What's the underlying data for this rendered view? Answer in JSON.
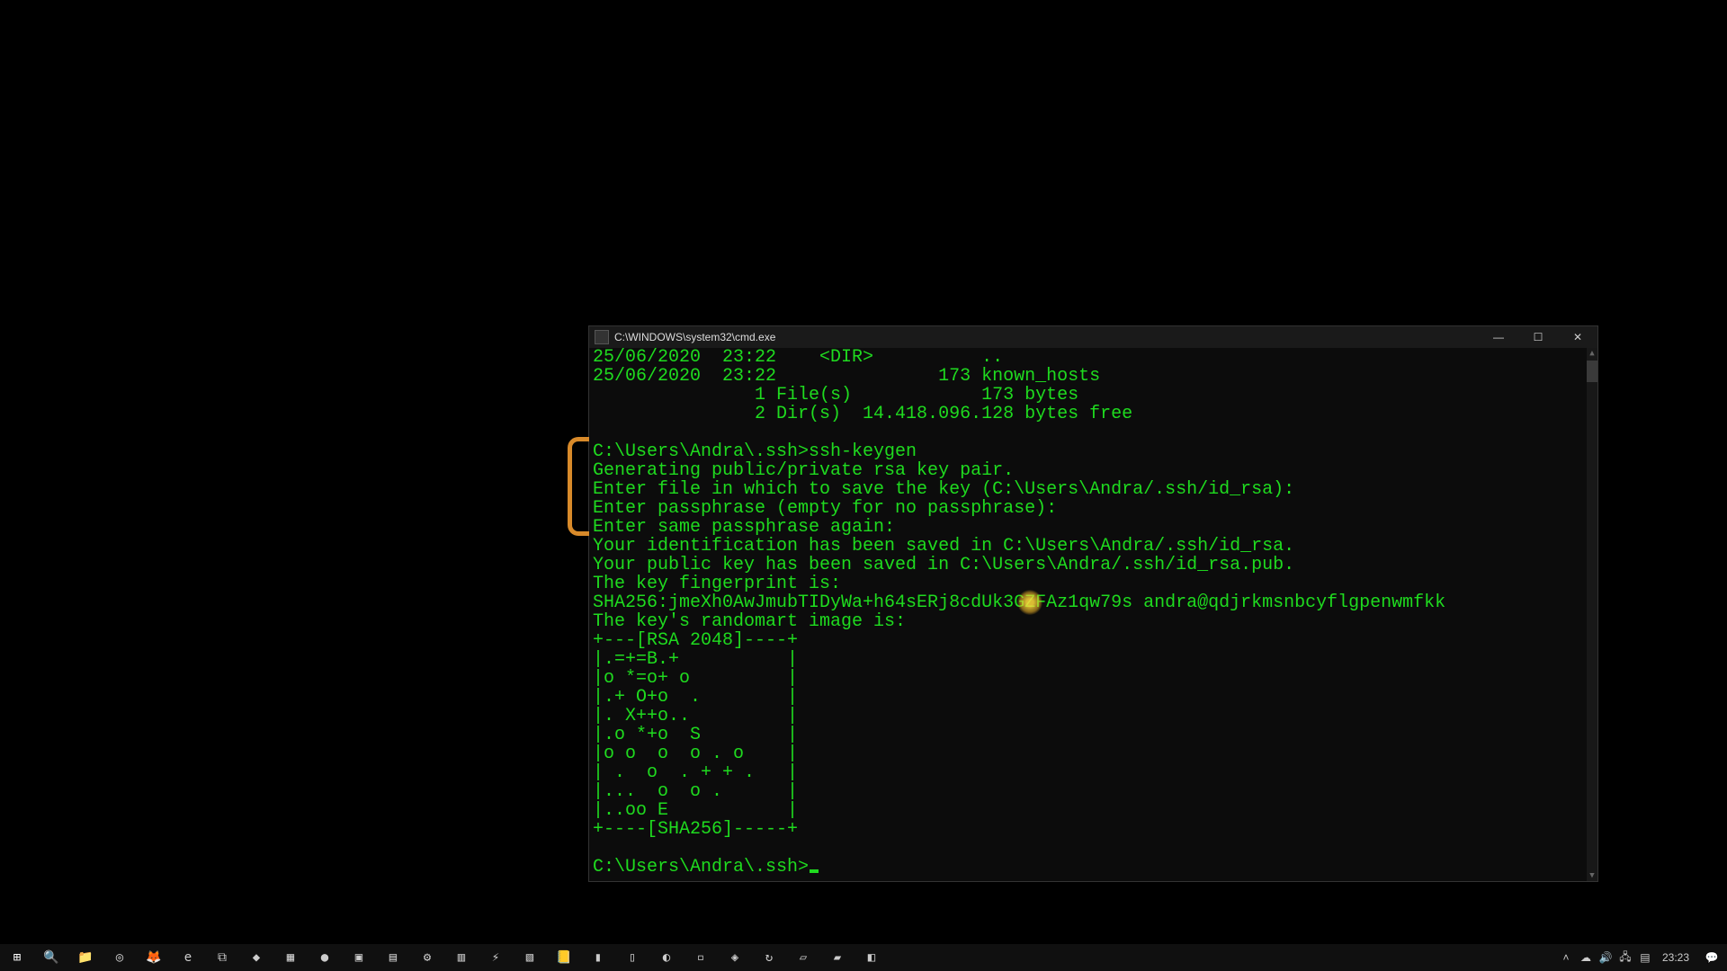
{
  "window": {
    "title": "C:\\WINDOWS\\system32\\cmd.exe",
    "minimize": "—",
    "maximize": "☐",
    "close": "✕"
  },
  "terminal": {
    "lines": [
      "25/06/2020  23:22    <DIR>          ..",
      "25/06/2020  23:22               173 known_hosts",
      "               1 File(s)            173 bytes",
      "               2 Dir(s)  14.418.096.128 bytes free",
      "",
      "C:\\Users\\Andra\\.ssh>ssh-keygen",
      "Generating public/private rsa key pair.",
      "Enter file in which to save the key (C:\\Users\\Andra/.ssh/id_rsa):",
      "Enter passphrase (empty for no passphrase):",
      "Enter same passphrase again:",
      "Your identification has been saved in C:\\Users\\Andra/.ssh/id_rsa.",
      "Your public key has been saved in C:\\Users\\Andra/.ssh/id_rsa.pub.",
      "The key fingerprint is:",
      "SHA256:jmeXh0AwJmubTIDyWa+h64sERj8cdUk3GZFAz1qw79s andra@qdjrkmsnbcyflgpenwmfkk",
      "The key's randomart image is:",
      "+---[RSA 2048]----+",
      "|.=+=B.+          |",
      "|o *=o+ o         |",
      "|.+ O+o  .        |",
      "|. X++o..         |",
      "|.o *+o  S        |",
      "|o o  o  o . o    |",
      "| .  o  . + + .   |",
      "|...  o  o .      |",
      "|..oo E           |",
      "+----[SHA256]-----+",
      ""
    ],
    "prompt": "C:\\Users\\Andra\\.ssh>"
  },
  "taskbar": {
    "icons": [
      {
        "name": "start-button",
        "glyph": "⊞"
      },
      {
        "name": "search-icon",
        "glyph": "🔍"
      },
      {
        "name": "file-explorer-icon",
        "glyph": "📁"
      },
      {
        "name": "chrome-icon",
        "glyph": "◎"
      },
      {
        "name": "firefox-icon",
        "glyph": "🦊"
      },
      {
        "name": "edge-icon",
        "glyph": "e"
      },
      {
        "name": "vscode-icon",
        "glyph": "⧉"
      },
      {
        "name": "app-icon-1",
        "glyph": "◆"
      },
      {
        "name": "app-icon-2",
        "glyph": "▦"
      },
      {
        "name": "app-icon-3",
        "glyph": "●"
      },
      {
        "name": "cmd-icon",
        "glyph": "▣"
      },
      {
        "name": "app-icon-4",
        "glyph": "▤"
      },
      {
        "name": "settings-icon",
        "glyph": "⚙"
      },
      {
        "name": "app-icon-5",
        "glyph": "▥"
      },
      {
        "name": "app-icon-6",
        "glyph": "⚡"
      },
      {
        "name": "app-icon-7",
        "glyph": "▧"
      },
      {
        "name": "app-icon-8",
        "glyph": "📒"
      },
      {
        "name": "app-icon-9",
        "glyph": "▮"
      },
      {
        "name": "app-icon-10",
        "glyph": "▯"
      },
      {
        "name": "app-icon-11",
        "glyph": "◐"
      },
      {
        "name": "app-icon-12",
        "glyph": "▫"
      },
      {
        "name": "app-icon-13",
        "glyph": "◈"
      },
      {
        "name": "app-icon-14",
        "glyph": "↻"
      },
      {
        "name": "app-icon-15",
        "glyph": "▱"
      },
      {
        "name": "app-icon-16",
        "glyph": "▰"
      },
      {
        "name": "app-icon-17",
        "glyph": "◧"
      }
    ],
    "tray": [
      {
        "name": "tray-overflow-icon",
        "glyph": "˄"
      },
      {
        "name": "onedrive-icon",
        "glyph": "☁"
      },
      {
        "name": "volume-icon",
        "glyph": "🔊"
      },
      {
        "name": "network-icon",
        "glyph": "🖧"
      },
      {
        "name": "language-icon",
        "glyph": "▤"
      }
    ],
    "clock_time": "23:23",
    "notification_glyph": "💬"
  }
}
